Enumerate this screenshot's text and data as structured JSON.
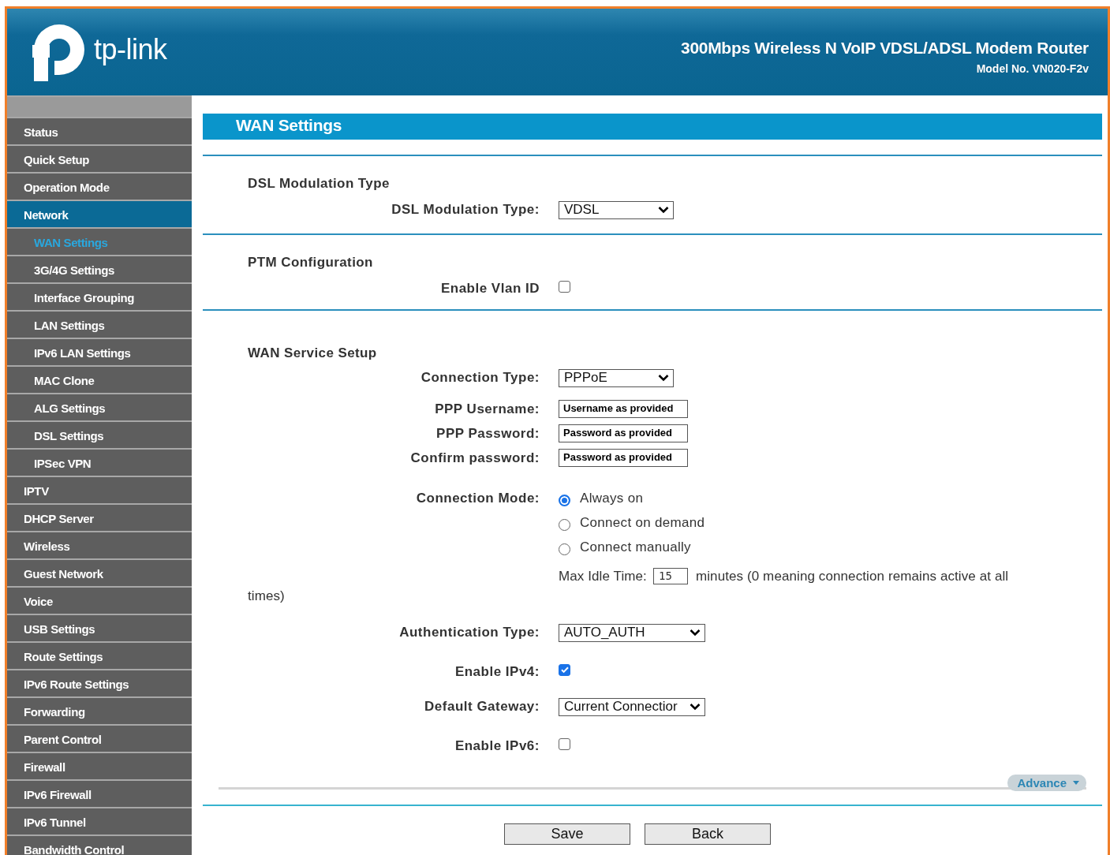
{
  "header": {
    "brand": "tp-link",
    "product": "300Mbps Wireless N VoIP VDSL/ADSL Modem Router",
    "model": "Model No. VN020-F2v"
  },
  "sidebar": {
    "items": [
      {
        "label": "Status",
        "selected": false
      },
      {
        "label": "Quick Setup",
        "selected": false
      },
      {
        "label": "Operation Mode",
        "selected": false
      },
      {
        "label": "Network",
        "selected": true,
        "children": [
          {
            "label": "WAN Settings",
            "selected": true
          },
          {
            "label": "3G/4G Settings",
            "selected": false
          },
          {
            "label": "Interface Grouping",
            "selected": false
          },
          {
            "label": "LAN Settings",
            "selected": false
          },
          {
            "label": "IPv6 LAN Settings",
            "selected": false
          },
          {
            "label": "MAC Clone",
            "selected": false
          },
          {
            "label": "ALG Settings",
            "selected": false
          },
          {
            "label": "DSL Settings",
            "selected": false
          },
          {
            "label": "IPSec VPN",
            "selected": false
          }
        ]
      },
      {
        "label": "IPTV",
        "selected": false
      },
      {
        "label": "DHCP Server",
        "selected": false
      },
      {
        "label": "Wireless",
        "selected": false
      },
      {
        "label": "Guest Network",
        "selected": false
      },
      {
        "label": "Voice",
        "selected": false
      },
      {
        "label": "USB Settings",
        "selected": false
      },
      {
        "label": "Route Settings",
        "selected": false
      },
      {
        "label": "IPv6 Route Settings",
        "selected": false
      },
      {
        "label": "Forwarding",
        "selected": false
      },
      {
        "label": "Parent Control",
        "selected": false
      },
      {
        "label": "Firewall",
        "selected": false
      },
      {
        "label": "IPv6 Firewall",
        "selected": false
      },
      {
        "label": "IPv6 Tunnel",
        "selected": false
      },
      {
        "label": "Bandwidth Control",
        "selected": false
      }
    ]
  },
  "page": {
    "title": "WAN Settings",
    "sections": [
      {
        "heading": "DSL Modulation Type",
        "fields": [
          {
            "kind": "select",
            "label": "DSL Modulation Type:",
            "value": "VDSL"
          }
        ]
      },
      {
        "heading": "PTM Configuration",
        "fields": [
          {
            "kind": "checkbox",
            "label": "Enable Vlan ID",
            "checked": false
          }
        ]
      },
      {
        "heading": "WAN Service Setup",
        "fields": [
          {
            "kind": "select",
            "label": "Connection Type:",
            "value": "PPPoE"
          },
          {
            "kind": "text",
            "label": "PPP Username:",
            "value": "Username as provided"
          },
          {
            "kind": "text",
            "label": "PPP Password:",
            "value": "Password as provided"
          },
          {
            "kind": "text",
            "label": "Confirm password:",
            "value": "Password as provided"
          },
          {
            "kind": "radio",
            "label": "Connection Mode:",
            "options": [
              {
                "label": "Always on",
                "selected": true
              },
              {
                "label": "Connect on demand",
                "selected": false
              },
              {
                "label": "Connect manually",
                "selected": false
              }
            ]
          },
          {
            "kind": "idle",
            "label": "Max Idle Time:",
            "value": "15",
            "note": "minutes (0 meaning connection remains active at all",
            "note_continued": "times)"
          },
          {
            "kind": "wide-select",
            "label": "Authentication Type:",
            "value": "AUTO_AUTH"
          },
          {
            "kind": "checkbox",
            "label": "Enable IPv4:",
            "checked": true
          },
          {
            "kind": "wide-select",
            "label": "Default Gateway:",
            "value": "Current Connectior"
          },
          {
            "kind": "checkbox",
            "label": "Enable IPv6:",
            "checked": false
          }
        ]
      }
    ]
  },
  "advance": "Advance",
  "buttons": [
    "Save",
    "Back"
  ]
}
